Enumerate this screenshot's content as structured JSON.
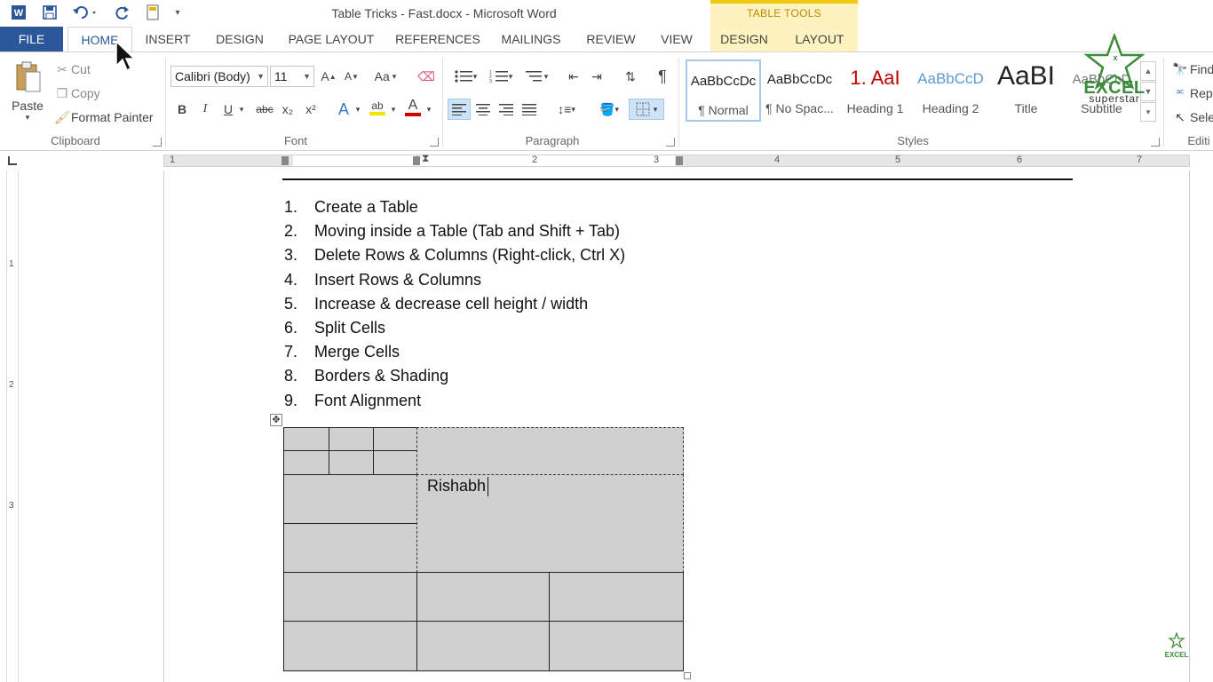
{
  "window": {
    "title": "Table Tricks - Fast.docx - Microsoft Word",
    "contextual_group": "TABLE TOOLS"
  },
  "quick_access": {
    "icons": [
      "word-app-icon",
      "save-icon",
      "undo-icon",
      "redo-icon",
      "new-doc-icon",
      "customize-qat-icon"
    ]
  },
  "tabs": [
    {
      "label": "FILE"
    },
    {
      "label": "HOME"
    },
    {
      "label": "INSERT"
    },
    {
      "label": "DESIGN"
    },
    {
      "label": "PAGE LAYOUT"
    },
    {
      "label": "REFERENCES"
    },
    {
      "label": "MAILINGS"
    },
    {
      "label": "REVIEW"
    },
    {
      "label": "VIEW"
    },
    {
      "label": "DESIGN"
    },
    {
      "label": "LAYOUT"
    }
  ],
  "active_tab": "HOME",
  "ribbon": {
    "clipboard": {
      "label": "Clipboard",
      "paste": "Paste",
      "cut": "Cut",
      "copy": "Copy",
      "format_painter": "Format Painter"
    },
    "font": {
      "label": "Font",
      "font_name": "Calibri (Body)",
      "font_size": "11",
      "grow": "A",
      "shrink": "A",
      "change_case": "Aa",
      "bold": "B",
      "italic": "I",
      "underline": "U",
      "strike": "abc",
      "subscript": "x₂",
      "superscript": "x²",
      "text_effects": "A",
      "highlight": "ab",
      "font_color": "A",
      "highlight_color": "#f5e400",
      "font_color_value": "#d00000"
    },
    "paragraph": {
      "label": "Paragraph",
      "show_marks": "¶"
    },
    "styles": {
      "label": "Styles",
      "items": [
        {
          "sample": "AaBbCcDc",
          "name": "¶ Normal"
        },
        {
          "sample": "AaBbCcDc",
          "name": "¶ No Spac..."
        },
        {
          "sample": "1.  AaI",
          "name": "Heading 1"
        },
        {
          "sample": "AaBbCcD",
          "name": "Heading 2"
        },
        {
          "sample": "AaBI",
          "name": "Title"
        },
        {
          "sample": "AaBbCcD",
          "name": "Subtitle"
        }
      ]
    },
    "editing": {
      "label": "Editi",
      "find": "Find",
      "replace": "Rep",
      "select": "Sele"
    }
  },
  "ruler": {
    "h_numbers": [
      "1",
      "1",
      "2",
      "3",
      "4",
      "5",
      "6",
      "7"
    ],
    "v_numbers": [
      "1",
      "2",
      "3"
    ]
  },
  "document": {
    "list": [
      {
        "num": "1.",
        "text": "Create a Table"
      },
      {
        "num": "2.",
        "text": "Moving inside a Table (Tab and Shift + Tab)"
      },
      {
        "num": "3.",
        "text": "Delete Rows & Columns (Right-click, Ctrl X)"
      },
      {
        "num": "4.",
        "text": "Insert Rows & Columns"
      },
      {
        "num": "5.",
        "text": "Increase & decrease cell height / width"
      },
      {
        "num": "6.",
        "text": "Split Cells"
      },
      {
        "num": "7.",
        "text": "Merge Cells"
      },
      {
        "num": "8.",
        "text": "Borders & Shading"
      },
      {
        "num": "9.",
        "text": "Font Alignment"
      }
    ],
    "table_cell_text": "Rishabh",
    "table_shading": "#d1d0d0"
  },
  "watermark": {
    "line1": "EXCEL",
    "line2": "superstar",
    "small": "EXCEL"
  },
  "colors": {
    "file_tab": "#2b579a",
    "accent": "#2b579a",
    "table_tools": "#f2c811",
    "logo_green": "#3c8c3c"
  }
}
